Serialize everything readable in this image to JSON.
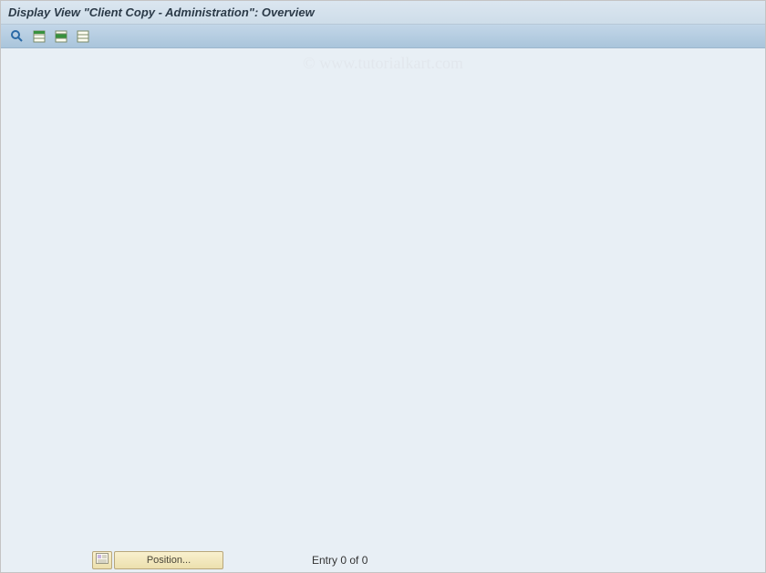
{
  "titlebar": {
    "title": "Display View \"Client Copy - Administration\": Overview"
  },
  "toolbar": {
    "buttons": [
      {
        "name": "detail-icon"
      },
      {
        "name": "select-all-icon"
      },
      {
        "name": "select-block-icon"
      },
      {
        "name": "deselect-all-icon"
      }
    ]
  },
  "watermark": "© www.tutorialkart.com",
  "footer": {
    "position_label": "Position...",
    "entry_text": "Entry 0 of 0"
  }
}
